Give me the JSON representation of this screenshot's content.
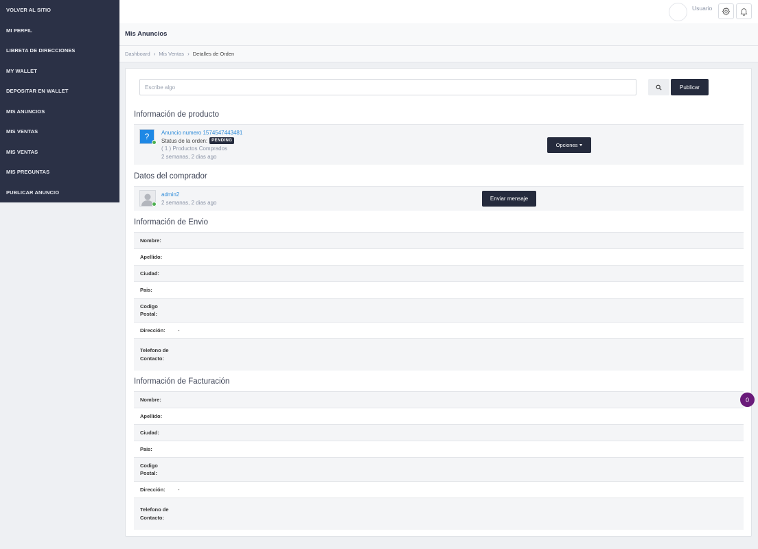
{
  "sidebar": {
    "items": [
      {
        "label": "VOLVER AL SITIO"
      },
      {
        "label": "MI PERFIL"
      },
      {
        "label": "LIBRETA DE DIRECCIONES"
      },
      {
        "label": "MY WALLET"
      },
      {
        "label": "DEPOSITAR EN WALLET"
      },
      {
        "label": "MIS ANUNCIOS"
      },
      {
        "label": "MIS VENTAS"
      },
      {
        "label": "MIS VENTAS"
      },
      {
        "label": "MIS PREGUNTAS"
      },
      {
        "label": "PUBLICAR ANUNCIO"
      }
    ],
    "background": "#2b3146"
  },
  "topbar": {
    "user_name": "Usuario",
    "settings_icon": "gear-icon",
    "notifications_icon": "bell-icon"
  },
  "page": {
    "title": "Mis Anuncios"
  },
  "breadcrumb": {
    "items": [
      "Dashboard",
      "Mis Ventas",
      "Detalles de Orden"
    ],
    "separator": "›"
  },
  "search": {
    "placeholder": "Escribe algo",
    "value": "",
    "button_icon": "search-icon",
    "publish_label": "Publicar"
  },
  "product": {
    "section_title": "Información de producto",
    "thumb_glyph": "?",
    "name": "Anuncio numero 1574547443481",
    "status_label": "Status de la orden:",
    "status_value": "PENDING",
    "purchased": "( 1 ) Productos Comprados",
    "time_ago": "2 semanas, 2 dias ago",
    "options_label": "Opciones"
  },
  "buyer": {
    "section_title": "Datos del comprador",
    "name": "admin2",
    "time_ago": "2 semanas, 2 dias ago",
    "message_label": "Enviar mensaje"
  },
  "shipping": {
    "section_title": "Información de Envio",
    "rows": [
      {
        "label": "Nombre:",
        "value": ""
      },
      {
        "label": "Apellido:",
        "value": ""
      },
      {
        "label": "Ciudad:",
        "value": ""
      },
      {
        "label": "Pais:",
        "value": ""
      },
      {
        "label": "Codigo Postal:",
        "value": ""
      },
      {
        "label": "Dirección:",
        "value": "-"
      },
      {
        "label": "Telefono de Contacto:",
        "value": ""
      }
    ]
  },
  "billing": {
    "section_title": "Información de Facturación",
    "rows": [
      {
        "label": "Nombre:",
        "value": ""
      },
      {
        "label": "Apellido:",
        "value": ""
      },
      {
        "label": "Ciudad:",
        "value": ""
      },
      {
        "label": "Pais:",
        "value": ""
      },
      {
        "label": "Codigo Postal:",
        "value": ""
      },
      {
        "label": "Dirección:",
        "value": "-"
      },
      {
        "label": "Telefono de Contacto:",
        "value": ""
      }
    ]
  },
  "floating_badge": {
    "count": "0",
    "color": "#6a1b7a"
  },
  "colors": {
    "primary_button": "#252b3d",
    "link": "#2e8bd8",
    "online": "#4caf50",
    "thumb": "#1e88e5"
  }
}
